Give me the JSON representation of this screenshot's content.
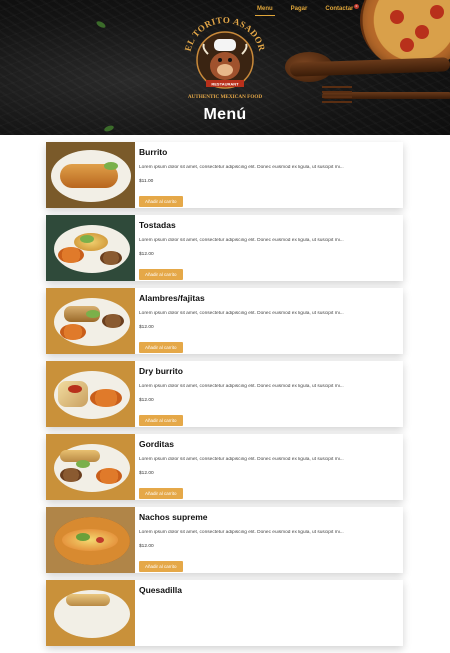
{
  "header": {
    "nav": [
      {
        "label": "Menu",
        "active": true
      },
      {
        "label": "Pagar",
        "active": false
      },
      {
        "label": "Contactar",
        "active": false
      }
    ],
    "cart_count": "0",
    "logo": {
      "name": "EL TORITO ASADOR",
      "subtitle": "RESTAURANT",
      "tagline": "AUTHENTIC MEXICAN FOOD"
    },
    "page_title": "Menú"
  },
  "menu": [
    {
      "name": "Burrito",
      "description": "Lorem ipsum dolor sit amet, consectetur adipiscing elit. Donec euismod ex ligula, ut suscipit mi...",
      "price": "$11.00",
      "button": "Añadir al carrito"
    },
    {
      "name": "Tostadas",
      "description": "Lorem ipsum dolor sit amet, consectetur adipiscing elit. Donec euismod ex ligula, ut suscipit mi...",
      "price": "$12.00",
      "button": "Añadir al carrito"
    },
    {
      "name": "Alambres/fajitas",
      "description": "Lorem ipsum dolor sit amet, consectetur adipiscing elit. Donec euismod ex ligula, ut suscipit mi...",
      "price": "$12.00",
      "button": "Añadir al carrito"
    },
    {
      "name": "Dry burrito",
      "description": "Lorem ipsum dolor sit amet, consectetur adipiscing elit. Donec euismod ex ligula, ut suscipit mi...",
      "price": "$12.00",
      "button": "Añadir al carrito"
    },
    {
      "name": "Gorditas",
      "description": "Lorem ipsum dolor sit amet, consectetur adipiscing elit. Donec euismod ex ligula, ut suscipit mi...",
      "price": "$12.00",
      "button": "Añadir al carrito"
    },
    {
      "name": "Nachos supreme",
      "description": "Lorem ipsum dolor sit amet, consectetur adipiscing elit. Donec euismod ex ligula, ut suscipit mi...",
      "price": "$12.00",
      "button": "Añadir al carrito"
    },
    {
      "name": "Quesadilla",
      "description": "",
      "price": "",
      "button": ""
    }
  ],
  "colors": {
    "accent": "#e5a848",
    "nav_text": "#e0a63a",
    "hero_bg": "#141414"
  }
}
